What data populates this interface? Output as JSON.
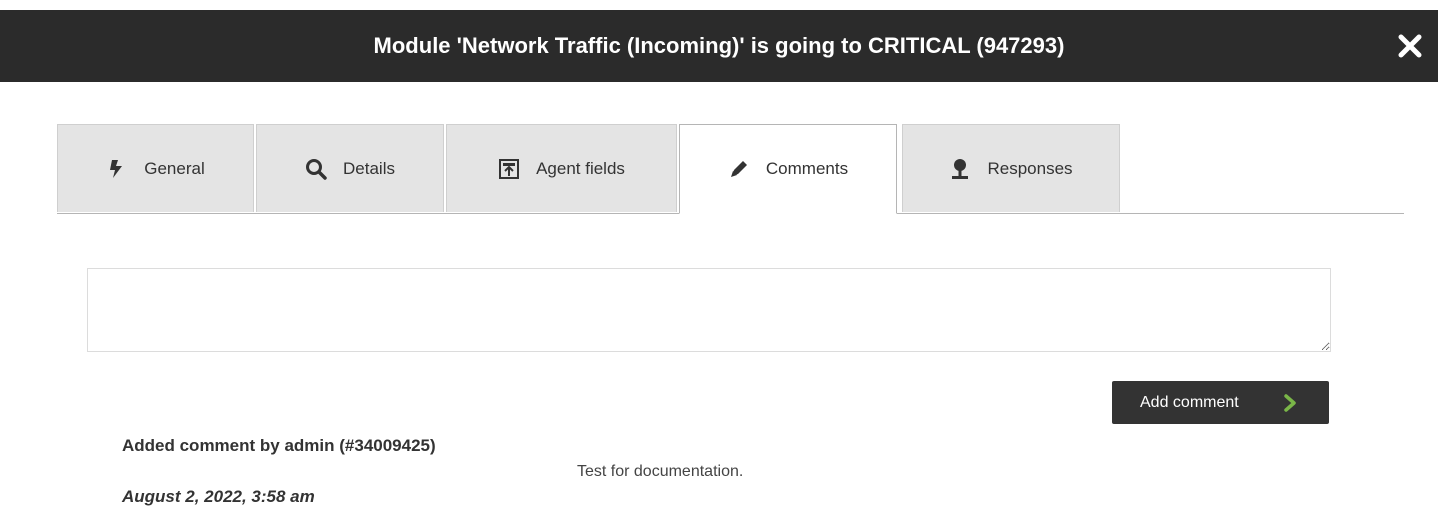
{
  "dialog": {
    "title": "Module 'Network Traffic (Incoming)' is going to CRITICAL (947293)",
    "close_icon": "close-icon"
  },
  "tabs": [
    {
      "label": "General",
      "icon": "flash-icon",
      "active": false
    },
    {
      "label": "Details",
      "icon": "search-icon",
      "active": false
    },
    {
      "label": "Agent fields",
      "icon": "agent-fields-icon",
      "active": false
    },
    {
      "label": "Comments",
      "icon": "pencil-icon",
      "active": true
    },
    {
      "label": "Responses",
      "icon": "pushpin-icon",
      "active": false
    }
  ],
  "comment_form": {
    "value": "",
    "button_label": "Add comment",
    "button_icon": "chevron-right-icon",
    "accent_color": "#7ab648"
  },
  "comments": [
    {
      "author": "Added comment by admin (#34009425)",
      "date": "August 2, 2022, 3:58 am",
      "text": "Test for documentation."
    }
  ]
}
